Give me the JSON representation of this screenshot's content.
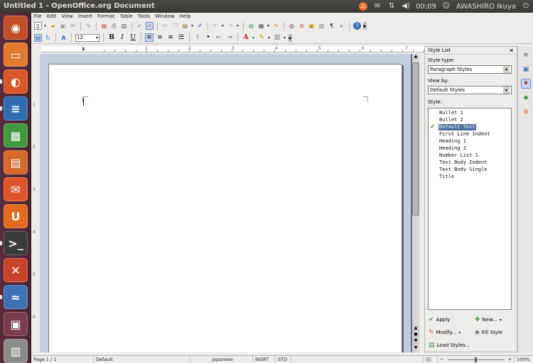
{
  "window": {
    "title": "Untitled 1 - OpenOffice.org Document"
  },
  "tray": {
    "clock": "00:09",
    "user": "AWASHIRO Ikuya"
  },
  "launcher": {
    "items": [
      {
        "name": "ubuntu-dash-icon",
        "glyph": "◉",
        "color": "#c24e28"
      },
      {
        "name": "files-icon",
        "glyph": "▭",
        "color": "#e27a32"
      },
      {
        "name": "firefox-icon",
        "glyph": "◐",
        "color": "#d9582a"
      },
      {
        "name": "writer-icon",
        "glyph": "≡",
        "color": "#2f6db3"
      },
      {
        "name": "calc-icon",
        "glyph": "▦",
        "color": "#3f9a3f"
      },
      {
        "name": "impress-icon",
        "glyph": "▤",
        "color": "#d56a2a"
      },
      {
        "name": "software-center-icon",
        "glyph": "✉",
        "color": "#e0552d"
      },
      {
        "name": "ubuntu-one-icon",
        "glyph": "U",
        "color": "#e46a1f"
      },
      {
        "name": "terminal-icon",
        "glyph": ">_",
        "color": "#3a3a3a"
      },
      {
        "name": "system-settings-icon",
        "glyph": "✕",
        "color": "#c8432a"
      },
      {
        "name": "openoffice-icon",
        "glyph": "≈",
        "color": "#3f72b5"
      },
      {
        "name": "workspace-switcher-icon",
        "glyph": "▣",
        "color": "#7b3c4d"
      },
      {
        "name": "trash-icon",
        "glyph": "▥",
        "color": "#8a8a86"
      }
    ]
  },
  "menu": [
    "File",
    "Edit",
    "View",
    "Insert",
    "Format",
    "Table",
    "Tools",
    "Window",
    "Help"
  ],
  "format": {
    "font_size": "12",
    "bold": "B",
    "italic": "I",
    "underline": "U",
    "font_color_glyph": "A"
  },
  "ruler": {
    "numbers": [
      "1",
      "2",
      "3",
      "4",
      "5",
      "6",
      "7"
    ]
  },
  "vruler": {
    "numbers": [
      "1",
      "2",
      "3",
      "4",
      "5",
      "6"
    ]
  },
  "style_list": {
    "title": "Style List",
    "type_label": "Style type:",
    "type_value": "Paragraph Styles",
    "view_label": "View by:",
    "view_value": "Default Styles",
    "style_label": "Style:",
    "items": [
      "Bullet 1",
      "Bullet 2",
      "Default Text",
      "First Line Indent",
      "Heading 1",
      "Heading 2",
      "Number List 1",
      "Text Body Indent",
      "Text Body Single",
      "Title"
    ],
    "selected": "Default Text",
    "buttons": {
      "apply": "Apply",
      "new": "New...",
      "modify": "Modify...",
      "fill": "Fill Style",
      "load": "Load Styles..."
    }
  },
  "status": {
    "page": "Page 1 / 1",
    "style": "Default",
    "language": "Japanese",
    "insert_mode": "INSRT",
    "selection_mode": "STD",
    "zoom": "100%"
  }
}
